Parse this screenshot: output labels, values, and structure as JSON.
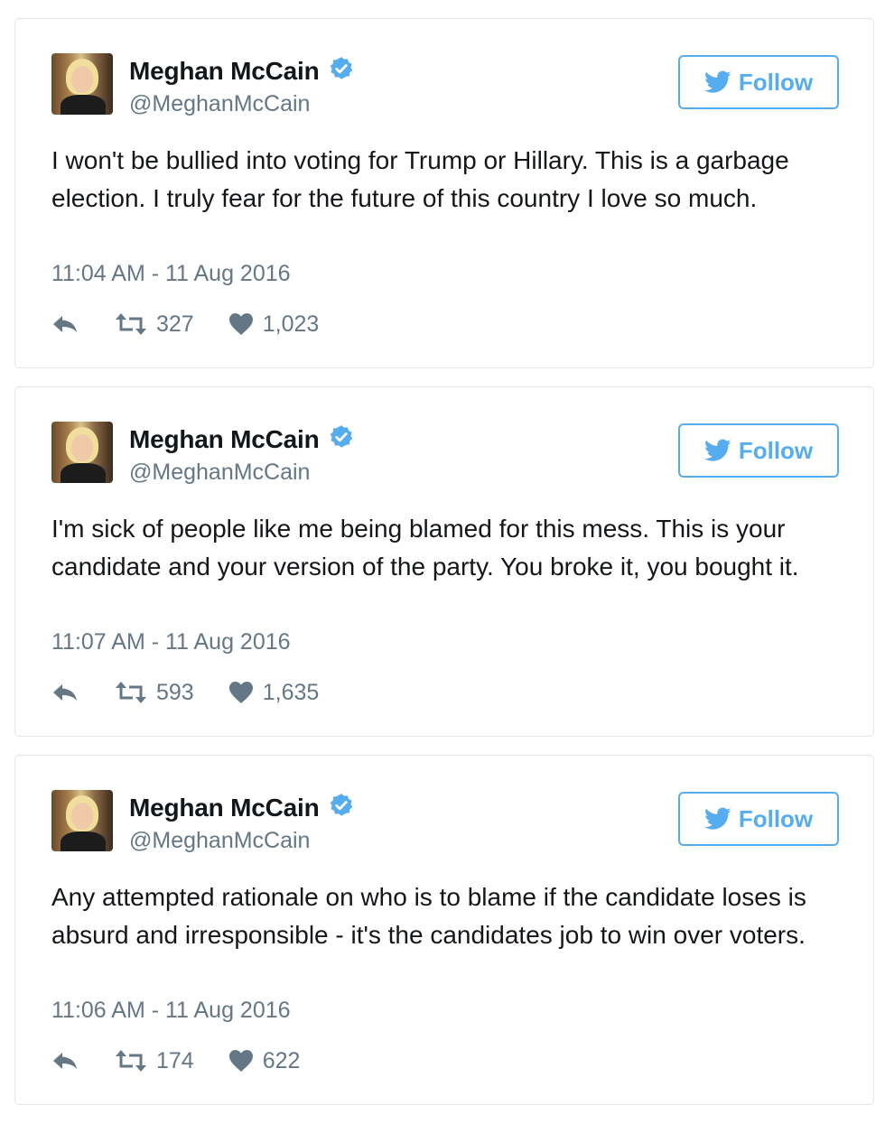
{
  "colors": {
    "accent": "#55acee",
    "secondary_text": "#657786",
    "primary_text": "#14171a",
    "border": "#e1e8ed"
  },
  "tweets": [
    {
      "author_name": "Meghan McCain",
      "handle": "@MeghanMcCain",
      "follow_label": "Follow",
      "text": "I won't be bullied into voting for Trump or Hillary. This is a garbage election. I truly fear for the future of this country I love so much.",
      "timestamp": "11:04 AM - 11 Aug 2016",
      "retweets": "327",
      "likes": "1,023"
    },
    {
      "author_name": "Meghan McCain",
      "handle": "@MeghanMcCain",
      "follow_label": "Follow",
      "text": "I'm sick of people like me being blamed for this mess. This is your candidate and your version of the party. You broke it, you bought it.",
      "timestamp": "11:07 AM - 11 Aug 2016",
      "retweets": "593",
      "likes": "1,635"
    },
    {
      "author_name": "Meghan McCain",
      "handle": "@MeghanMcCain",
      "follow_label": "Follow",
      "text": "Any attempted rationale on who is to blame if the candidate loses is absurd and irresponsible - it's the candidates job to win over voters.",
      "timestamp": "11:06 AM - 11 Aug 2016",
      "retweets": "174",
      "likes": "622"
    }
  ]
}
